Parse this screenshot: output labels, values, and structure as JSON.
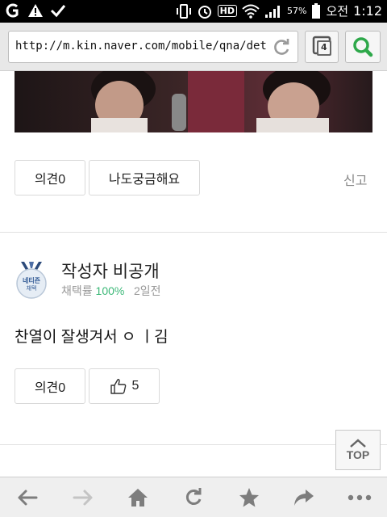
{
  "status_bar": {
    "battery": "57%",
    "ampm": "오전",
    "time": "1:12",
    "hd": "HD"
  },
  "browser": {
    "url": "http://m.kin.naver.com/mobile/qna/det",
    "tab_count": "4"
  },
  "question_actions": {
    "opinion_label": "의견0",
    "curious_label": "나도궁금해요",
    "report_label": "신고"
  },
  "answer": {
    "badge_top": "네티즌",
    "badge_bottom": "채택",
    "author": "작성자 비공개",
    "meta_prefix": "채택률",
    "adoption_rate": "100%",
    "time_ago": "2일전",
    "content": "찬열이 잘생겨서 ㅇ ㅣ김",
    "opinion_label": "의견0",
    "like_count": "5"
  },
  "top_button": "TOP",
  "colors": {
    "accent_green": "#3cb878",
    "search_green": "#2ea84a"
  }
}
